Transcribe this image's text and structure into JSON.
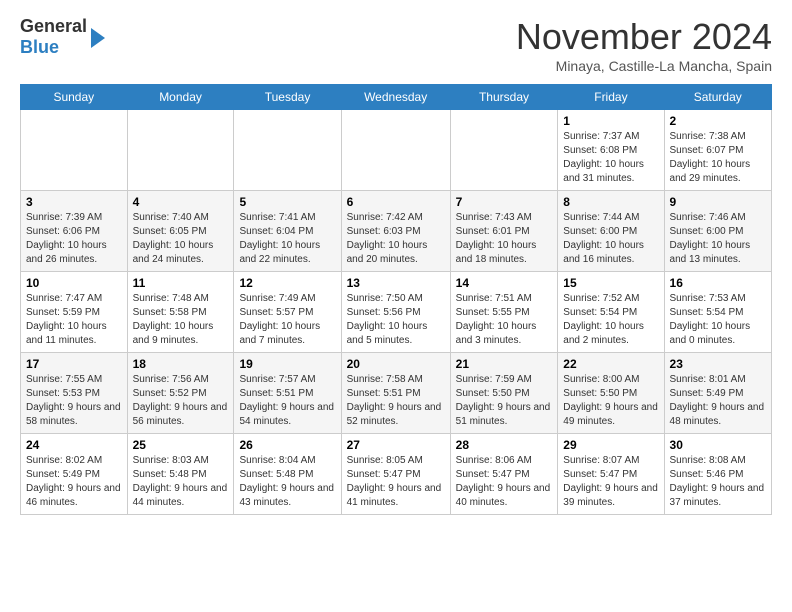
{
  "header": {
    "logo_line1": "General",
    "logo_line2": "Blue",
    "month_title": "November 2024",
    "location": "Minaya, Castille-La Mancha, Spain"
  },
  "weekdays": [
    "Sunday",
    "Monday",
    "Tuesday",
    "Wednesday",
    "Thursday",
    "Friday",
    "Saturday"
  ],
  "weeks": [
    [
      {
        "day": "",
        "info": ""
      },
      {
        "day": "",
        "info": ""
      },
      {
        "day": "",
        "info": ""
      },
      {
        "day": "",
        "info": ""
      },
      {
        "day": "",
        "info": ""
      },
      {
        "day": "1",
        "info": "Sunrise: 7:37 AM\nSunset: 6:08 PM\nDaylight: 10 hours and 31 minutes."
      },
      {
        "day": "2",
        "info": "Sunrise: 7:38 AM\nSunset: 6:07 PM\nDaylight: 10 hours and 29 minutes."
      }
    ],
    [
      {
        "day": "3",
        "info": "Sunrise: 7:39 AM\nSunset: 6:06 PM\nDaylight: 10 hours and 26 minutes."
      },
      {
        "day": "4",
        "info": "Sunrise: 7:40 AM\nSunset: 6:05 PM\nDaylight: 10 hours and 24 minutes."
      },
      {
        "day": "5",
        "info": "Sunrise: 7:41 AM\nSunset: 6:04 PM\nDaylight: 10 hours and 22 minutes."
      },
      {
        "day": "6",
        "info": "Sunrise: 7:42 AM\nSunset: 6:03 PM\nDaylight: 10 hours and 20 minutes."
      },
      {
        "day": "7",
        "info": "Sunrise: 7:43 AM\nSunset: 6:01 PM\nDaylight: 10 hours and 18 minutes."
      },
      {
        "day": "8",
        "info": "Sunrise: 7:44 AM\nSunset: 6:00 PM\nDaylight: 10 hours and 16 minutes."
      },
      {
        "day": "9",
        "info": "Sunrise: 7:46 AM\nSunset: 6:00 PM\nDaylight: 10 hours and 13 minutes."
      }
    ],
    [
      {
        "day": "10",
        "info": "Sunrise: 7:47 AM\nSunset: 5:59 PM\nDaylight: 10 hours and 11 minutes."
      },
      {
        "day": "11",
        "info": "Sunrise: 7:48 AM\nSunset: 5:58 PM\nDaylight: 10 hours and 9 minutes."
      },
      {
        "day": "12",
        "info": "Sunrise: 7:49 AM\nSunset: 5:57 PM\nDaylight: 10 hours and 7 minutes."
      },
      {
        "day": "13",
        "info": "Sunrise: 7:50 AM\nSunset: 5:56 PM\nDaylight: 10 hours and 5 minutes."
      },
      {
        "day": "14",
        "info": "Sunrise: 7:51 AM\nSunset: 5:55 PM\nDaylight: 10 hours and 3 minutes."
      },
      {
        "day": "15",
        "info": "Sunrise: 7:52 AM\nSunset: 5:54 PM\nDaylight: 10 hours and 2 minutes."
      },
      {
        "day": "16",
        "info": "Sunrise: 7:53 AM\nSunset: 5:54 PM\nDaylight: 10 hours and 0 minutes."
      }
    ],
    [
      {
        "day": "17",
        "info": "Sunrise: 7:55 AM\nSunset: 5:53 PM\nDaylight: 9 hours and 58 minutes."
      },
      {
        "day": "18",
        "info": "Sunrise: 7:56 AM\nSunset: 5:52 PM\nDaylight: 9 hours and 56 minutes."
      },
      {
        "day": "19",
        "info": "Sunrise: 7:57 AM\nSunset: 5:51 PM\nDaylight: 9 hours and 54 minutes."
      },
      {
        "day": "20",
        "info": "Sunrise: 7:58 AM\nSunset: 5:51 PM\nDaylight: 9 hours and 52 minutes."
      },
      {
        "day": "21",
        "info": "Sunrise: 7:59 AM\nSunset: 5:50 PM\nDaylight: 9 hours and 51 minutes."
      },
      {
        "day": "22",
        "info": "Sunrise: 8:00 AM\nSunset: 5:50 PM\nDaylight: 9 hours and 49 minutes."
      },
      {
        "day": "23",
        "info": "Sunrise: 8:01 AM\nSunset: 5:49 PM\nDaylight: 9 hours and 48 minutes."
      }
    ],
    [
      {
        "day": "24",
        "info": "Sunrise: 8:02 AM\nSunset: 5:49 PM\nDaylight: 9 hours and 46 minutes."
      },
      {
        "day": "25",
        "info": "Sunrise: 8:03 AM\nSunset: 5:48 PM\nDaylight: 9 hours and 44 minutes."
      },
      {
        "day": "26",
        "info": "Sunrise: 8:04 AM\nSunset: 5:48 PM\nDaylight: 9 hours and 43 minutes."
      },
      {
        "day": "27",
        "info": "Sunrise: 8:05 AM\nSunset: 5:47 PM\nDaylight: 9 hours and 41 minutes."
      },
      {
        "day": "28",
        "info": "Sunrise: 8:06 AM\nSunset: 5:47 PM\nDaylight: 9 hours and 40 minutes."
      },
      {
        "day": "29",
        "info": "Sunrise: 8:07 AM\nSunset: 5:47 PM\nDaylight: 9 hours and 39 minutes."
      },
      {
        "day": "30",
        "info": "Sunrise: 8:08 AM\nSunset: 5:46 PM\nDaylight: 9 hours and 37 minutes."
      }
    ]
  ]
}
